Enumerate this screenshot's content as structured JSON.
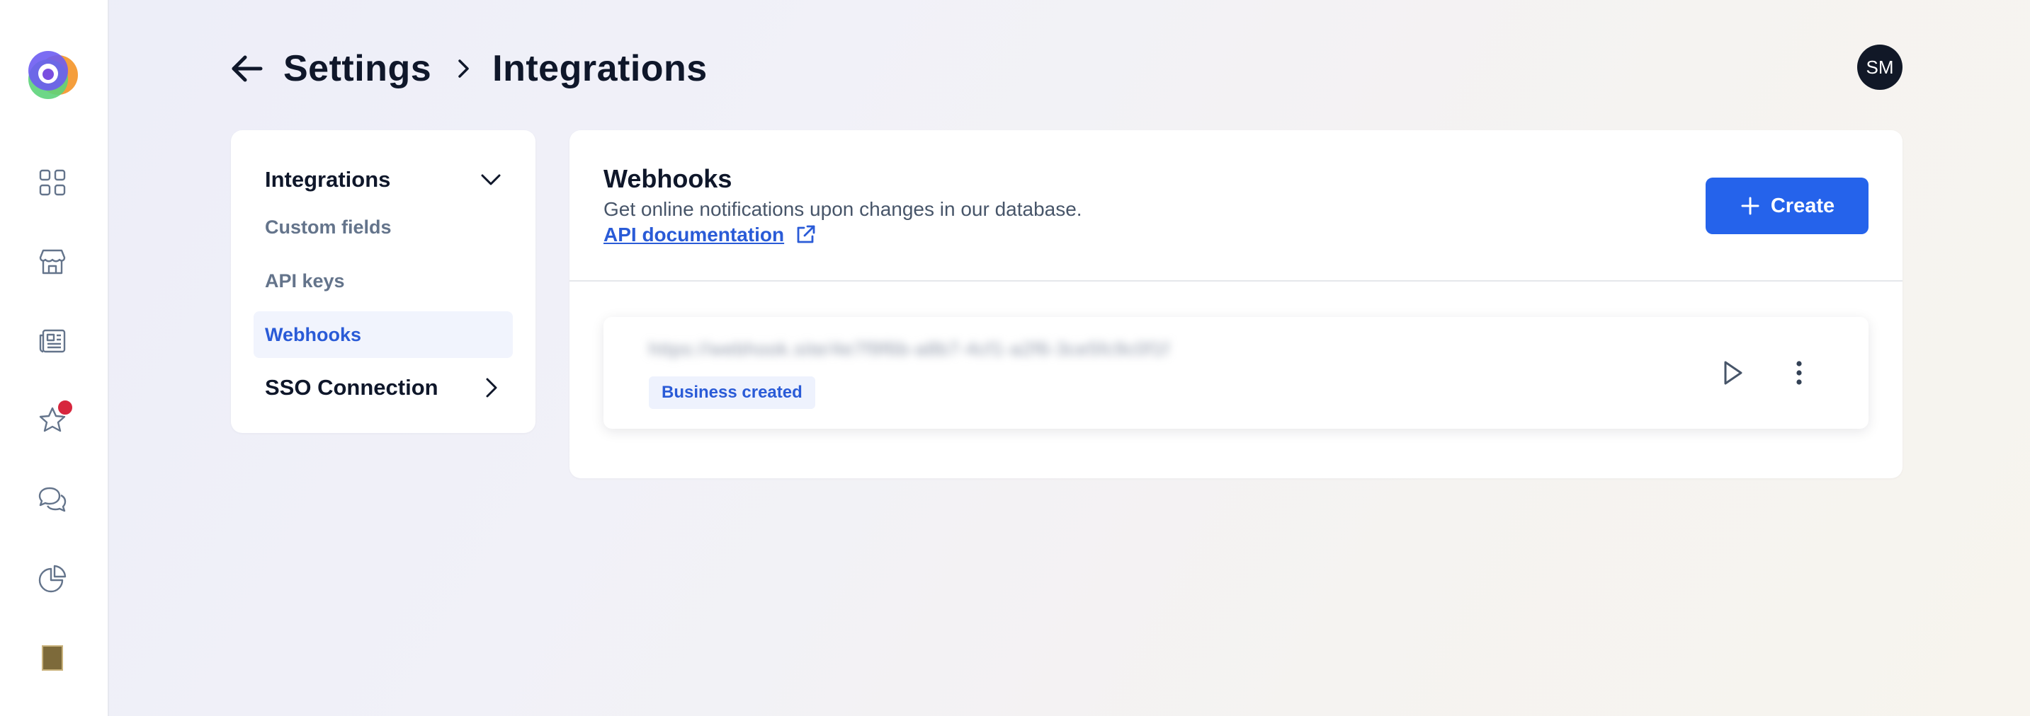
{
  "sidebar": {
    "items": [
      {
        "icon": "grid-icon"
      },
      {
        "icon": "store-icon"
      },
      {
        "icon": "newspaper-icon"
      },
      {
        "icon": "star-icon",
        "has_notification": true
      },
      {
        "icon": "chat-bubbles-icon"
      },
      {
        "icon": "pie-chart-icon"
      }
    ]
  },
  "header": {
    "breadcrumb": [
      "Settings",
      "Integrations"
    ],
    "avatar_initials": "SM"
  },
  "subnav": {
    "group_title": "Integrations",
    "items": [
      {
        "label": "Custom fields",
        "active": false
      },
      {
        "label": "API keys",
        "active": false
      },
      {
        "label": "Webhooks",
        "active": true
      }
    ],
    "sso_title": "SSO Connection"
  },
  "panel": {
    "title": "Webhooks",
    "description": "Get online notifications upon changes in our database.",
    "api_link_label": "API documentation",
    "create_label": "Create",
    "webhooks": [
      {
        "url": "https://webhook.site/4e7f9f6b-a8b7-4cf1-a2f6-3ce5fc9c0f1f",
        "event": "Business created"
      }
    ]
  },
  "colors": {
    "accent": "#2563eb",
    "link": "#2a5bd7",
    "notification": "#d7263d",
    "avatar_bg": "#111827"
  }
}
